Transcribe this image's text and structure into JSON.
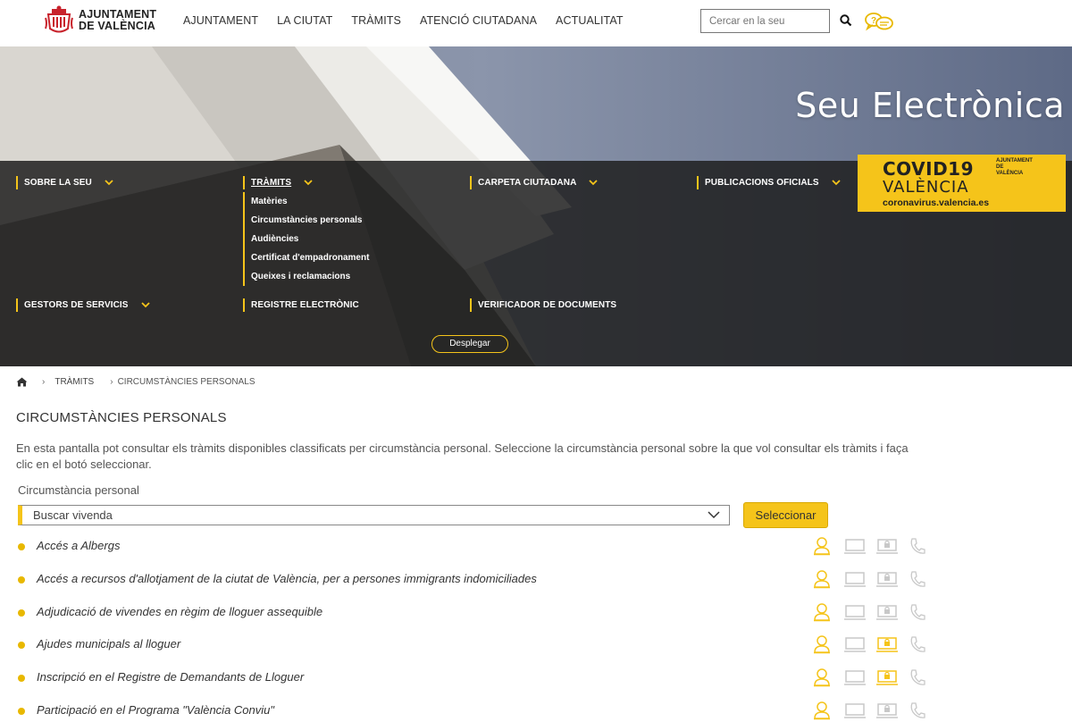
{
  "header": {
    "logo_line1": "AJUNTAMENT",
    "logo_line2": "DE VALÈNCIA",
    "nav": [
      "AJUNTAMENT",
      "LA CIUTAT",
      "TRÀMITS",
      "ATENCIÓ CIUTADANA",
      "ACTUALITAT"
    ],
    "search_placeholder": "Cercar en la seu"
  },
  "hero": {
    "title": "Seu Electrònica",
    "menu": {
      "sobre": "SOBRE LA SEU",
      "tramits": "TRÀMITS",
      "tramits_items": [
        "Matèries",
        "Circumstàncies personals",
        "Audiències",
        "Certificat d'empadronament",
        "Queixes i reclamacions"
      ],
      "carpeta": "CARPETA CIUTADANA",
      "publicacions": "PUBLICACIONS OFICIALS",
      "gestors": "GESTORS DE SERVICIS",
      "registre": "REGISTRE ELECTRÒNIC",
      "verificador": "VERIFICADOR DE DOCUMENTS",
      "desplegar": "Desplegar"
    },
    "covid": {
      "title": "COVID19",
      "city": "VALÈNCIA",
      "url": "coronavirus.valencia.es",
      "ajuntament": "AJUNTAMENT DE VALÈNCIA"
    }
  },
  "breadcrumb": {
    "level1": "TRÀMITS",
    "level2": "CIRCUMSTÀNCIES PERSONALS"
  },
  "main": {
    "title": "CIRCUMSTÀNCIES PERSONALS",
    "intro": "En esta pantalla pot consultar els tràmits disponibles classificats per circumstància personal. Seleccione la circumstància personal sobre la que vol consultar els tràmits i faça clic en el botó seleccionar.",
    "field_label": "Circumstància personal",
    "selected_value": "Buscar vivenda",
    "button_label": "Seleccionar"
  },
  "colors": {
    "accent": "#f5c41a",
    "bullet": "#e8b800",
    "icon_inactive": "#c8c8c8"
  },
  "procedures": [
    {
      "title": "Accés a Albergs",
      "presencial": true,
      "online": false,
      "electronic": false,
      "phone": false
    },
    {
      "title": "Accés a recursos d'allotjament de la ciutat de València, per a persones immigrants indomiciliades",
      "presencial": true,
      "online": false,
      "electronic": false,
      "phone": false
    },
    {
      "title": "Adjudicació de vivendes en règim de lloguer assequible",
      "presencial": true,
      "online": false,
      "electronic": false,
      "phone": false
    },
    {
      "title": "Ajudes municipals al lloguer",
      "presencial": true,
      "online": false,
      "electronic": true,
      "phone": false
    },
    {
      "title": "Inscripció en el Registre de Demandants de Lloguer",
      "presencial": true,
      "online": false,
      "electronic": true,
      "phone": false
    },
    {
      "title": "Participació en el Programa \"València Conviu\"",
      "presencial": true,
      "online": false,
      "electronic": false,
      "phone": false
    }
  ]
}
